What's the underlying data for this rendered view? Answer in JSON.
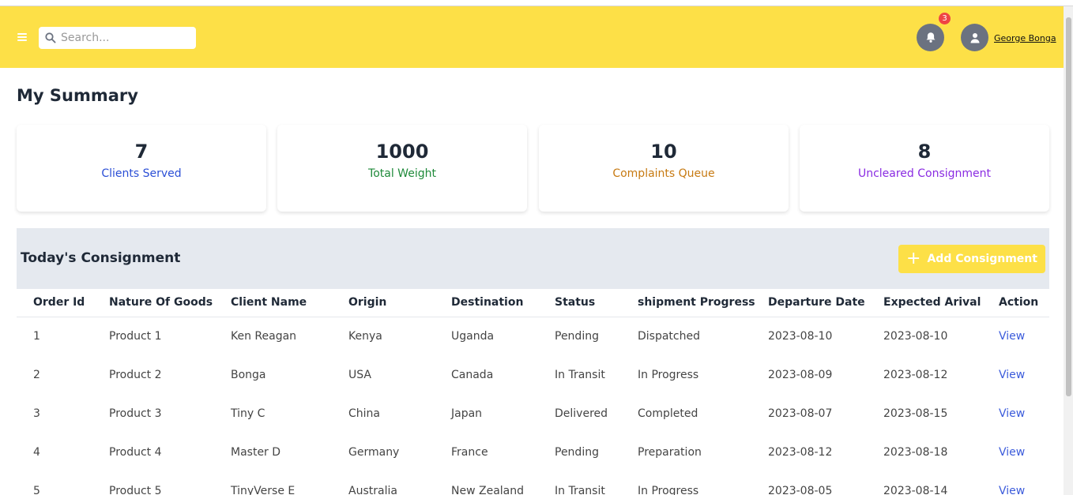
{
  "search": {
    "placeholder": "Search..."
  },
  "notifications": {
    "count": "3"
  },
  "user": {
    "name": "George Bonga"
  },
  "page": {
    "title": "My Summary"
  },
  "cards": [
    {
      "value": "7",
      "label": "Clients Served",
      "color": "#2b4fd6"
    },
    {
      "value": "1000",
      "label": "Total Weight",
      "color": "#1f8a3a"
    },
    {
      "value": "10",
      "label": "Complaints Queue",
      "color": "#c77a12"
    },
    {
      "value": "8",
      "label": "Uncleared Consignment",
      "color": "#8a2be2"
    }
  ],
  "consignment": {
    "title": "Today's Consignment",
    "add_label": "Add Consignment",
    "columns": [
      "Order Id",
      "Nature Of Goods",
      "Client Name",
      "Origin",
      "Destination",
      "Status",
      "shipment Progress",
      "Departure Date",
      "Expected Arival",
      "Action"
    ],
    "rows": [
      [
        "1",
        "Product 1",
        "Ken Reagan",
        "Kenya",
        "Uganda",
        "Pending",
        "Dispatched",
        "2023-08-10",
        "2023-08-10",
        "View"
      ],
      [
        "2",
        "Product 2",
        "Bonga",
        "USA",
        "Canada",
        "In Transit",
        "In Progress",
        "2023-08-09",
        "2023-08-12",
        "View"
      ],
      [
        "3",
        "Product 3",
        "Tiny C",
        "China",
        "Japan",
        "Delivered",
        "Completed",
        "2023-08-07",
        "2023-08-15",
        "View"
      ],
      [
        "4",
        "Product 4",
        "Master D",
        "Germany",
        "France",
        "Pending",
        "Preparation",
        "2023-08-12",
        "2023-08-18",
        "View"
      ],
      [
        "5",
        "Product 5",
        "TinyVerse E",
        "Australia",
        "New Zealand",
        "In Transit",
        "In Progress",
        "2023-08-05",
        "2023-08-14",
        "View"
      ]
    ]
  },
  "colors": {
    "header": "#fde047",
    "link": "#3b5bdb",
    "badge": "#ef4444"
  }
}
